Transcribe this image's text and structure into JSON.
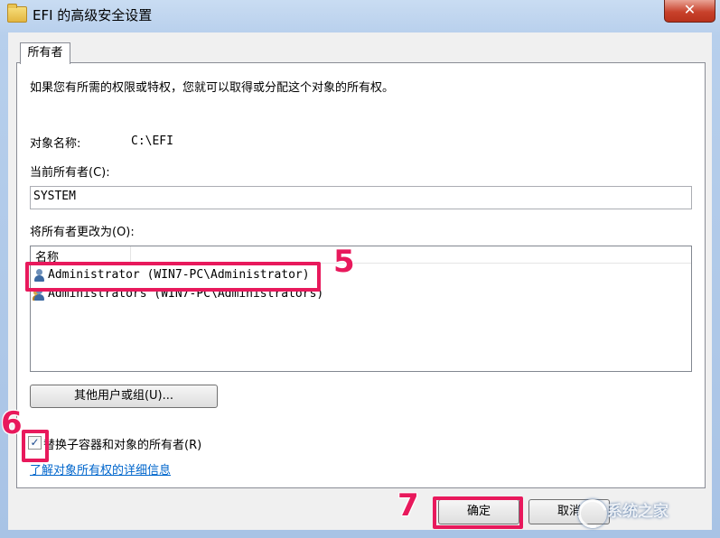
{
  "window": {
    "title": "EFI 的高级安全设置",
    "close_glyph": "✕"
  },
  "tabs": [
    {
      "label": "所有者"
    }
  ],
  "owner_panel": {
    "intro": "如果您有所需的权限或特权，您就可以取得或分配这个对象的所有权。",
    "object_name_label": "对象名称:",
    "object_name_value": "C:\\EFI",
    "current_owner_label": "当前所有者(C):",
    "current_owner_value": "SYSTEM",
    "change_owner_label": "将所有者更改为(O):",
    "list": {
      "column_header": "名称",
      "rows": [
        {
          "icon": "user-icon",
          "label": "Administrator (WIN7-PC\\Administrator)"
        },
        {
          "icon": "group-icon",
          "label": "Administrators (WIN7-PC\\Administrators)"
        }
      ]
    },
    "other_users_button": "其他用户或组(U)...",
    "replace_checkbox_label": "替换子容器和对象的所有者(R)",
    "replace_checked": true,
    "check_glyph": "✓",
    "learn_more_link": "了解对象所有权的详细信息"
  },
  "footer": {
    "ok_button": "确定",
    "cancel_button": "取消"
  },
  "annotations": {
    "step5": "5",
    "step6": "6",
    "step7": "7",
    "color": "#e8195c"
  },
  "watermark": "系统之家"
}
